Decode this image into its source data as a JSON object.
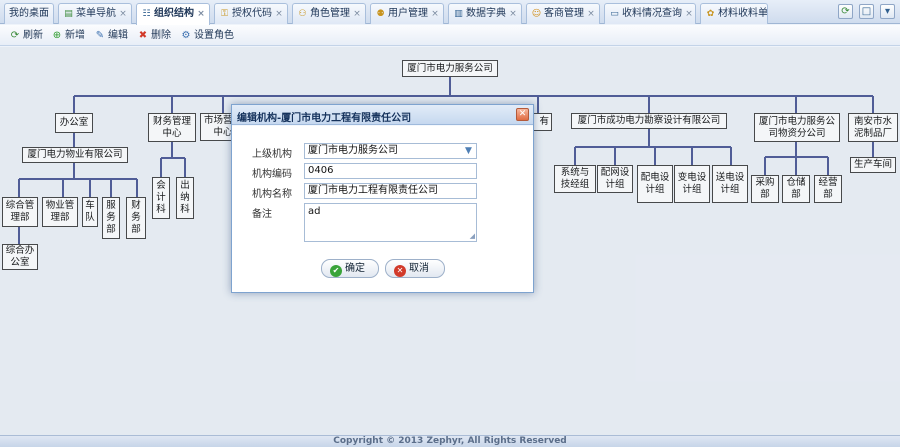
{
  "tabs": [
    {
      "label": "我的桌面",
      "icon": "none",
      "closable": false
    },
    {
      "label": "菜单导航",
      "icon": "menu-icon",
      "closable": true
    },
    {
      "label": "组织结构",
      "icon": "org-icon",
      "closable": true,
      "active": true
    },
    {
      "label": "授权代码",
      "icon": "key-icon",
      "closable": true
    },
    {
      "label": "角色管理",
      "icon": "role-icon",
      "closable": true
    },
    {
      "label": "用户管理",
      "icon": "user-icon",
      "closable": true
    },
    {
      "label": "数据字典",
      "icon": "book-icon",
      "closable": true
    },
    {
      "label": "客商管理",
      "icon": "customer-icon",
      "closable": true
    },
    {
      "label": "收料情况查询",
      "icon": "window-icon",
      "closable": true
    },
    {
      "label": "材料收料单",
      "icon": "material-icon",
      "closable": true
    }
  ],
  "tab_close_glyph": "×",
  "toolbar": [
    {
      "label": "刷新",
      "icon": "refresh-icon"
    },
    {
      "label": "新增",
      "icon": "add-icon"
    },
    {
      "label": "编辑",
      "icon": "edit-icon"
    },
    {
      "label": "删除",
      "icon": "delete-icon"
    },
    {
      "label": "设置角色",
      "icon": "set-role-icon"
    }
  ],
  "org": {
    "root": "厦门市电力服务公司",
    "office": "办公室",
    "property_company": "厦门电力物业有限公司",
    "property_departments": [
      "综合管理部",
      "物业管理部",
      "车队",
      "服务部",
      "财务部"
    ],
    "general_office": "综合办公室",
    "finance_center": "财务管理中心",
    "finance_children": [
      "会计科",
      "出纳科"
    ],
    "marketing_center": "市场营销中心",
    "hidden_suffix": "有",
    "survey_company": "厦门市成功电力勘察设计有限公司",
    "survey_departments": [
      "系统与技经组",
      "配网设计组",
      "配电设计组",
      "变电设计组",
      "送电设计组"
    ],
    "supply_company": "厦门市电力服务公司物资分公司",
    "supply_departments": [
      "采购部",
      "仓储部",
      "经营部"
    ],
    "cement_factory": "南安市水泥制品厂",
    "cement_children": [
      "生产车间"
    ]
  },
  "dialog": {
    "title": "编辑机构-厦门市电力工程有限责任公司",
    "close_glyph": "✕",
    "fields": {
      "parent_label": "上级机构",
      "parent_value": "厦门市电力服务公司",
      "code_label": "机构编码",
      "code_value": "0406",
      "name_label": "机构名称",
      "name_value": "厦门市电力工程有限责任公司",
      "remark_label": "备注",
      "remark_value": "ad"
    },
    "ok_label": "确定",
    "cancel_label": "取消"
  },
  "footer": "Copyright © 2013 Zephyr, All Rights Reserved",
  "colors": {
    "tree_line": "#4e5a96",
    "accent": "#2f5f8f"
  }
}
